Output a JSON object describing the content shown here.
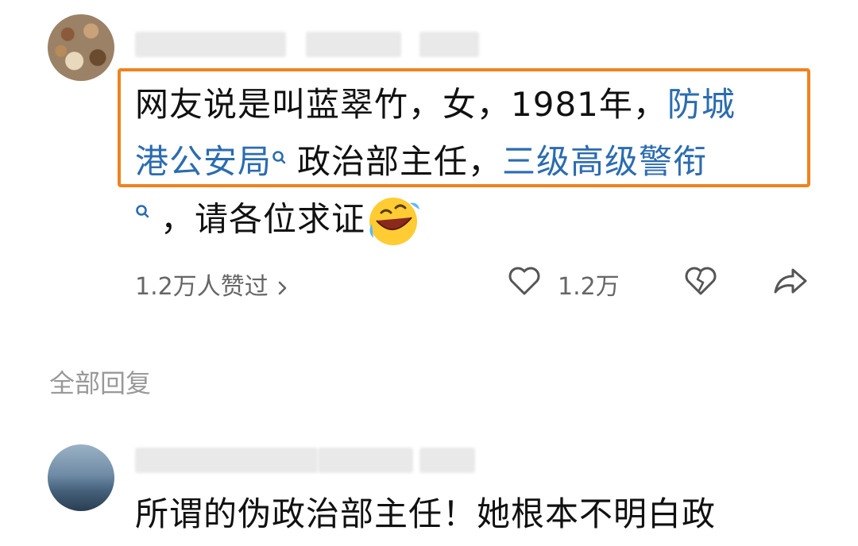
{
  "comment": {
    "line1_text": "网友说是叫蓝翠竹，女，1981年，",
    "line1_link": "防城",
    "line2_link": "港公安局",
    "line2_text": "政治部主任，",
    "line2_link2": "三级高级警衔",
    "line3_text": "，请各位求证",
    "emoji_icon": "rolling-laughing-emoji",
    "search_icon": "search-icon"
  },
  "actions": {
    "likes_summary": "1.2万人赞过",
    "like_count": "1.2万",
    "like_icon": "heart-icon",
    "dislike_icon": "broken-heart-icon",
    "share_icon": "share-icon",
    "chevron_icon": "chevron-right-icon"
  },
  "replies_section": {
    "label": "全部回复"
  },
  "reply": {
    "text": "所谓的伪政治部主任！她根本不明白政"
  },
  "colors": {
    "highlight_border": "#f0821e",
    "link": "#2b6cb0",
    "muted": "#999999"
  }
}
